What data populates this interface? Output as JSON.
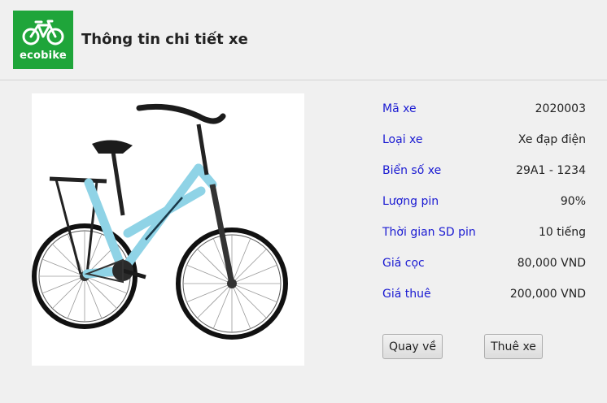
{
  "header": {
    "logo_text": "ecobike",
    "title": "Thông tin chi tiết xe"
  },
  "product_image": "bike-photo",
  "details": [
    {
      "label": "Mã xe",
      "value": "2020003"
    },
    {
      "label": "Loại xe",
      "value": "Xe đạp điện"
    },
    {
      "label": "Biển số xe",
      "value": "29A1 - 1234"
    },
    {
      "label": "Lượng pin",
      "value": "90%"
    },
    {
      "label": "Thời gian SD pin",
      "value": "10 tiếng"
    },
    {
      "label": "Giá cọc",
      "value": "80,000 VND"
    },
    {
      "label": "Giá thuê",
      "value": "200,000 VND"
    }
  ],
  "buttons": {
    "back_label": "Quay về",
    "rent_label": "Thuê xe"
  },
  "colors": {
    "brand": "#1fa53a",
    "label": "#1a1ad2",
    "bike_frame": "#8fd3e6"
  }
}
